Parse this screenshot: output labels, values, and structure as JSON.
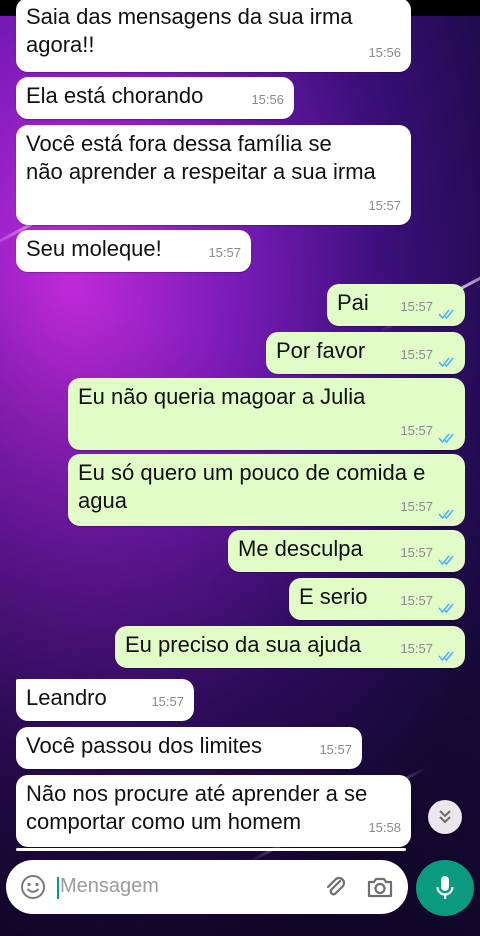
{
  "colors": {
    "incoming": "#ffffff",
    "outgoing": "#e2fcc8",
    "accent": "#0a9a7e",
    "tick": "#4fb3f6"
  },
  "messages": [
    {
      "dir": "in",
      "text": "Saia das mensagens da sua irma\nagora!!",
      "time": "15:56"
    },
    {
      "dir": "in",
      "text": "Ela está chorando",
      "time": "15:56"
    },
    {
      "dir": "in",
      "text": "Você está fora dessa família se\nnão aprender a respeitar a sua irma",
      "time": "15:57"
    },
    {
      "dir": "in",
      "text": "Seu moleque!",
      "time": "15:57"
    },
    {
      "dir": "out",
      "text": "Pai",
      "time": "15:57",
      "status": "read"
    },
    {
      "dir": "out",
      "text": "Por favor",
      "time": "15:57",
      "status": "read"
    },
    {
      "dir": "out",
      "text": "Eu não queria magoar a Julia",
      "time": "15:57",
      "status": "read"
    },
    {
      "dir": "out",
      "text": "Eu só quero um pouco de comida e\nagua",
      "time": "15:57",
      "status": "read"
    },
    {
      "dir": "out",
      "text": "Me desculpa",
      "time": "15:57",
      "status": "read"
    },
    {
      "dir": "out",
      "text": "E serio",
      "time": "15:57",
      "status": "read"
    },
    {
      "dir": "out",
      "text": "Eu preciso da sua ajuda",
      "time": "15:57",
      "status": "read"
    },
    {
      "dir": "in",
      "text": "Leandro",
      "time": "15:57"
    },
    {
      "dir": "in",
      "text": "Você passou dos limites",
      "time": "15:57"
    },
    {
      "dir": "in",
      "text": "Não nos procure até aprender a se\ncomportar como um homem",
      "time": "15:58"
    }
  ],
  "composer": {
    "placeholder": "Mensagem"
  },
  "icons": {
    "emoji": "emoji-icon",
    "attach": "paperclip-icon",
    "camera": "camera-icon",
    "mic": "microphone-icon",
    "scroll": "double-chevron-down-icon"
  }
}
